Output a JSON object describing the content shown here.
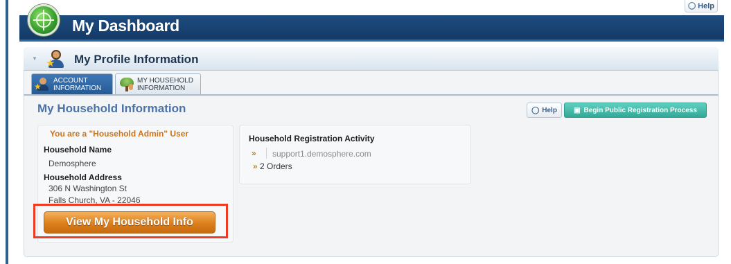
{
  "header": {
    "help_label": "Help",
    "title": "My Dashboard"
  },
  "profile": {
    "section_title": "My Profile Information",
    "tabs": [
      {
        "label_line1": "ACCOUNT",
        "label_line2": "INFORMATION",
        "active": true
      },
      {
        "label_line1": "MY HOUSEHOLD",
        "label_line2": "INFORMATION",
        "active": false
      }
    ]
  },
  "household": {
    "title": "My Household Information",
    "help_label": "Help",
    "register_label": "Begin Public Registration Process",
    "admin_note": "You are a \"Household Admin\" User",
    "name_label": "Household Name",
    "name_value": "Demosphere",
    "address_label": "Household Address",
    "address_line1": "306 N Washington St",
    "address_line2": "Falls Church, VA - 22046",
    "view_button": "View My Household Info"
  },
  "activity": {
    "title": "Household Registration Activity",
    "site_marker": "»",
    "site": "support1.demosphere.com",
    "orders_marker": "»",
    "orders": "2 Orders"
  },
  "colors": {
    "header_blue": "#1d4c7f",
    "accent_orange": "#dc7f1c",
    "teal_button": "#33a896",
    "highlight_red": "#ee3b23"
  },
  "icons": {
    "help": "speech-bubble-icon",
    "register": "cart-icon",
    "logo": "globe-crosshair-icon",
    "profile": "user-star-icon",
    "household": "tree-family-icon"
  }
}
